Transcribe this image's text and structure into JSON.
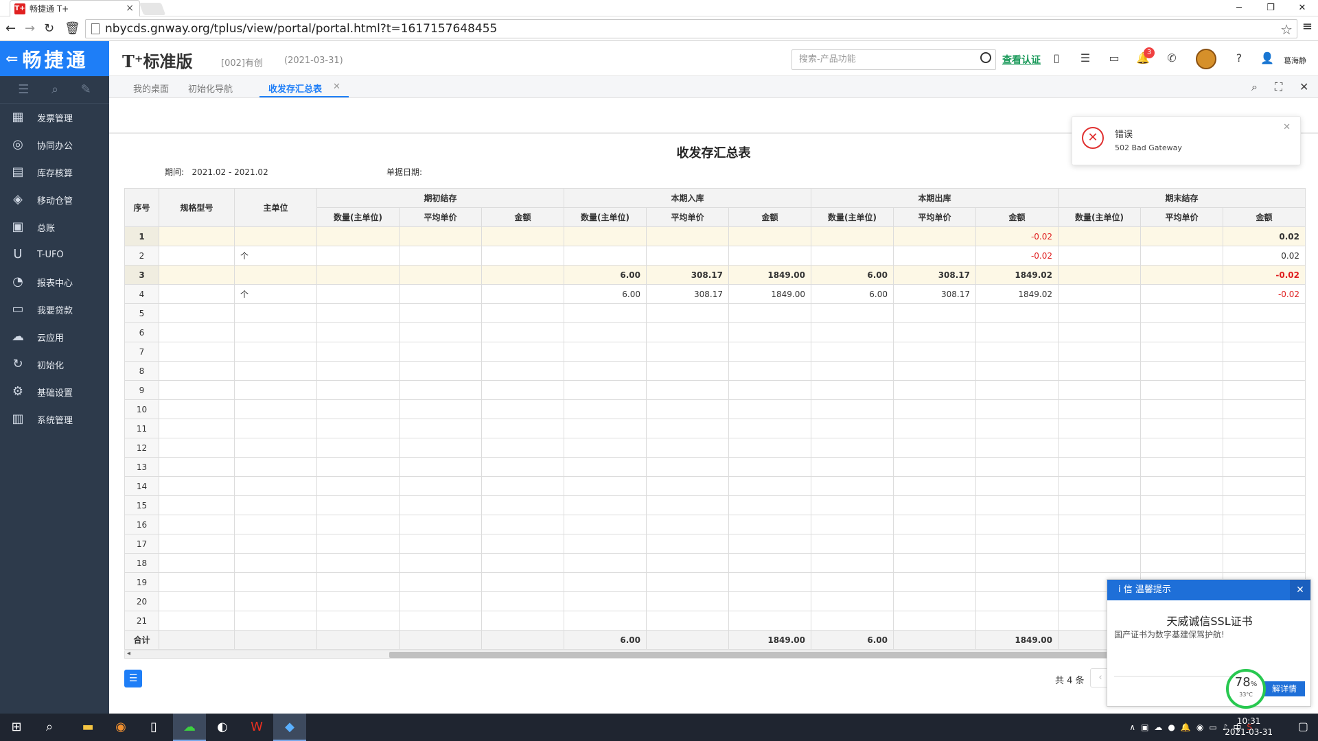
{
  "browser": {
    "tab_title": "畅捷通 T+",
    "tab_favicon": "T+",
    "url": "nbycds.gnway.org/tplus/view/portal/portal.html?t=1617157648455"
  },
  "header": {
    "logo": "畅捷通",
    "product": "T⁺标准版",
    "org": "[002]有创",
    "date": "(2021-03-31)",
    "search_placeholder": "搜索-产品功能",
    "view_cert": "查看认证",
    "bell_count": "3",
    "username": "葛海静"
  },
  "sidebar": {
    "items": [
      {
        "label": "发票管理",
        "icon": "invoice-icon"
      },
      {
        "label": "协同办公",
        "icon": "collab-icon"
      },
      {
        "label": "库存核算",
        "icon": "inventory-icon"
      },
      {
        "label": "移动仓管",
        "icon": "mobile-warehouse-icon"
      },
      {
        "label": "总账",
        "icon": "ledger-icon"
      },
      {
        "label": "T-UFO",
        "icon": "ufo-icon"
      },
      {
        "label": "报表中心",
        "icon": "report-icon"
      },
      {
        "label": "我要贷款",
        "icon": "loan-icon"
      },
      {
        "label": "云应用",
        "icon": "cloud-icon"
      },
      {
        "label": "初始化",
        "icon": "init-icon"
      },
      {
        "label": "基础设置",
        "icon": "settings-icon"
      },
      {
        "label": "系统管理",
        "icon": "system-icon"
      }
    ]
  },
  "subtabs": [
    "我的桌面",
    "初始化导航",
    "收发存汇总表"
  ],
  "report": {
    "title": "收发存汇总表",
    "period_label": "期间:",
    "period_value": "2021.02 - 2021.02",
    "docdate_label": "单据日期:",
    "headers": {
      "idx": "序号",
      "spec": "规格型号",
      "unit": "主单位",
      "groups": [
        "期初结存",
        "本期入库",
        "本期出库",
        "期末结存"
      ],
      "sub": [
        "数量(主单位)",
        "平均单价",
        "金额"
      ]
    },
    "rows": [
      {
        "idx": "1",
        "unit": "",
        "c": [
          "",
          "",
          "",
          "",
          "",
          "",
          "",
          "",
          "-0.02",
          "",
          "",
          "0.02"
        ],
        "style": "yellow"
      },
      {
        "idx": "2",
        "unit": "个",
        "c": [
          "",
          "",
          "",
          "",
          "",
          "",
          "",
          "",
          "-0.02",
          "",
          "",
          "0.02"
        ],
        "style": ""
      },
      {
        "idx": "3",
        "unit": "",
        "c": [
          "",
          "",
          "",
          "6.00",
          "308.17",
          "1849.00",
          "6.00",
          "308.17",
          "1849.02",
          "",
          "",
          "-0.02"
        ],
        "style": "yellow"
      },
      {
        "idx": "4",
        "unit": "个",
        "c": [
          "",
          "",
          "",
          "6.00",
          "308.17",
          "1849.00",
          "6.00",
          "308.17",
          "1849.02",
          "",
          "",
          "-0.02"
        ],
        "style": ""
      }
    ],
    "empty_rows": [
      "5",
      "6",
      "7",
      "8",
      "9",
      "10",
      "11",
      "12",
      "13",
      "14",
      "15",
      "16",
      "17",
      "18",
      "19",
      "20",
      "21"
    ],
    "total": {
      "label": "合计",
      "c": [
        "",
        "",
        "",
        "6.00",
        "",
        "1849.00",
        "6.00",
        "",
        "1849.00",
        "",
        "",
        ""
      ]
    },
    "count": "共 4 条"
  },
  "toast": {
    "title": "错误",
    "message": "502 Bad Gateway"
  },
  "ssl_popup": {
    "header": "i 信  温馨提示",
    "title": "天威诚信SSL证书",
    "subtitle": "国产证书为数字基建保驾护航!",
    "button": "解详情",
    "gauge_value": "78",
    "gauge_unit": "%",
    "gauge_temp": "33°C"
  },
  "taskbar": {
    "time": "10:31",
    "date": "2021-03-31",
    "ime": "中"
  }
}
